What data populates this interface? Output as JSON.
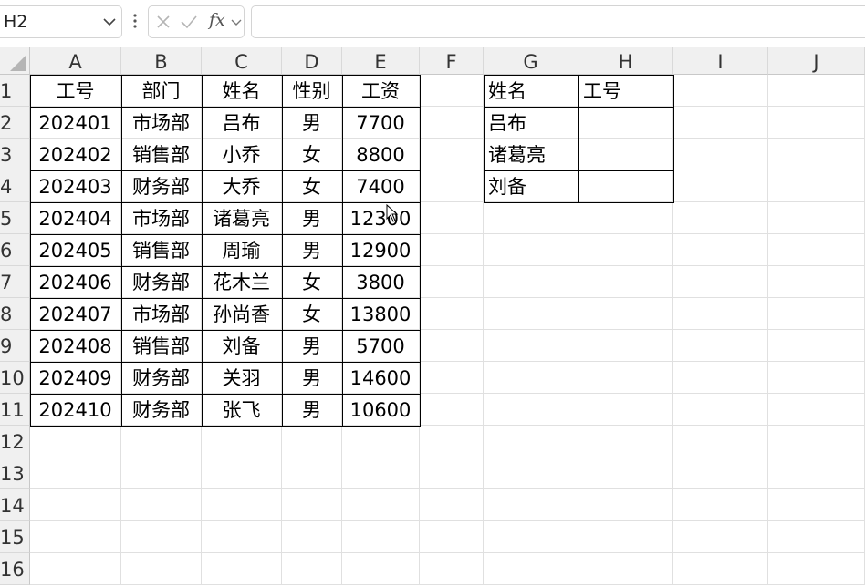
{
  "formula_bar": {
    "name_box": "H2",
    "fx": "fx",
    "formula": ""
  },
  "columns": [
    "A",
    "B",
    "C",
    "D",
    "E",
    "F",
    "G",
    "H",
    "I",
    "J"
  ],
  "rows": [
    "1",
    "2",
    "3",
    "4",
    "5",
    "6",
    "7",
    "8",
    "9",
    "10",
    "11",
    "12",
    "13",
    "14",
    "15",
    "16"
  ],
  "main_table": {
    "headers": [
      "工号",
      "部门",
      "姓名",
      "性别",
      "工资"
    ],
    "rows": [
      [
        "202401",
        "市场部",
        "吕布",
        "男",
        "7700"
      ],
      [
        "202402",
        "销售部",
        "小乔",
        "女",
        "8800"
      ],
      [
        "202403",
        "财务部",
        "大乔",
        "女",
        "7400"
      ],
      [
        "202404",
        "市场部",
        "诸葛亮",
        "男",
        "12300"
      ],
      [
        "202405",
        "销售部",
        "周瑜",
        "男",
        "12900"
      ],
      [
        "202406",
        "财务部",
        "花木兰",
        "女",
        "3800"
      ],
      [
        "202407",
        "市场部",
        "孙尚香",
        "女",
        "13800"
      ],
      [
        "202408",
        "销售部",
        "刘备",
        "男",
        "5700"
      ],
      [
        "202409",
        "财务部",
        "关羽",
        "男",
        "14600"
      ],
      [
        "202410",
        "财务部",
        "张飞",
        "男",
        "10600"
      ]
    ]
  },
  "lookup_table": {
    "headers": [
      "姓名",
      "工号"
    ],
    "rows": [
      [
        "吕布",
        ""
      ],
      [
        "诸葛亮",
        ""
      ],
      [
        "刘备",
        ""
      ]
    ]
  },
  "icons": {
    "name_box_dropdown": "chevron-down-icon",
    "more": "vertical-dots-icon",
    "cancel": "x-icon",
    "enter": "checkmark-icon",
    "fx_dropdown": "chevron-down-icon",
    "select_all": "select-all-triangle-icon",
    "pointer": "mouse-cursor-icon"
  }
}
